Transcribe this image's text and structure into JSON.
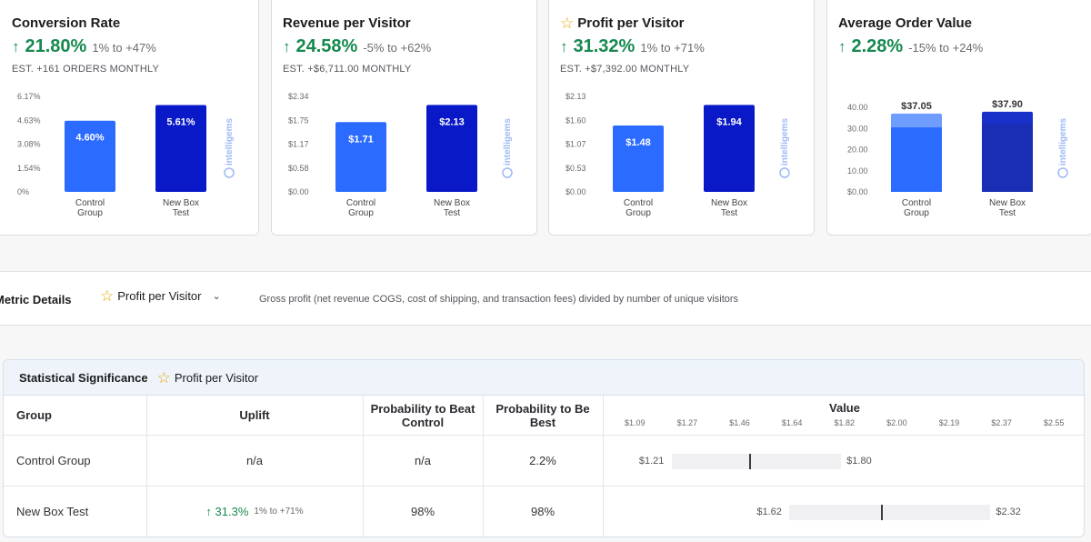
{
  "cards": [
    {
      "title": "Conversion Rate",
      "starred": false,
      "uplift": "21.80%",
      "range": "1% to +47%",
      "est": "EST. +161 ORDERS MONTHLY",
      "chart_data": {
        "type": "bar",
        "yticks": [
          "6.17%",
          "4.63%",
          "3.08%",
          "1.54%",
          "0%"
        ],
        "ymax": 6.17,
        "categories": [
          "Control Group",
          "New Box Test"
        ],
        "values": [
          4.6,
          5.61
        ],
        "labels": [
          "4.60%",
          "5.61%"
        ]
      }
    },
    {
      "title": "Revenue per Visitor",
      "starred": false,
      "uplift": "24.58%",
      "range": "-5% to +62%",
      "est": "EST. +$6,711.00 MONTHLY",
      "chart_data": {
        "type": "bar",
        "yticks": [
          "$2.34",
          "$1.75",
          "$1.17",
          "$0.58",
          "$0.00"
        ],
        "ymax": 2.34,
        "categories": [
          "Control Group",
          "New Box Test"
        ],
        "values": [
          1.71,
          2.13
        ],
        "labels": [
          "$1.71",
          "$2.13"
        ]
      }
    },
    {
      "title": "Profit per Visitor",
      "starred": true,
      "uplift": "31.32%",
      "range": "1% to +71%",
      "est": "EST. +$7,392.00 MONTHLY",
      "chart_data": {
        "type": "bar",
        "yticks": [
          "$2.13",
          "$1.60",
          "$1.07",
          "$0.53",
          "$0.00"
        ],
        "ymax": 2.13,
        "categories": [
          "Control Group",
          "New Box Test"
        ],
        "values": [
          1.48,
          1.94
        ],
        "labels": [
          "$1.48",
          "$1.94"
        ]
      }
    },
    {
      "title": "Average Order Value",
      "starred": false,
      "uplift": "2.28%",
      "range": "-15% to +24%",
      "est": "",
      "chart_data": {
        "type": "bar",
        "yticks": [
          "40.00",
          "30.00",
          "20.00",
          "10.00",
          "$0.00"
        ],
        "ymax": 40,
        "categories": [
          "Control Group",
          "New Box Test"
        ],
        "values": [
          37.05,
          37.9
        ],
        "labels": [
          "$37.05",
          "$37.90"
        ],
        "stacked_base": [
          30.5,
          32.0
        ]
      }
    }
  ],
  "brand_name": "intelligems",
  "details": {
    "label": "Metric Details",
    "selected_metric": "Profit per Visitor",
    "description": "Gross profit (net revenue COGS, cost of shipping, and transaction fees) divided by number of unique visitors"
  },
  "significance": {
    "title": "Statistical Significance",
    "metric": "Profit per Visitor",
    "headers": {
      "group": "Group",
      "uplift": "Uplift",
      "prob_beat": "Probability to Beat Control",
      "prob_best": "Probability to Be Best",
      "value": "Value"
    },
    "axis_ticks": [
      "$1.09",
      "$1.27",
      "$1.46",
      "$1.64",
      "$1.82",
      "$2.00",
      "$2.19",
      "$2.37",
      "$2.55"
    ],
    "axis_min": 1.09,
    "axis_max": 2.55,
    "rows": [
      {
        "group": "Control Group",
        "uplift": "n/a",
        "uplift_range": "",
        "prob_beat": "n/a",
        "prob_best": "2.2%",
        "ci_low": 1.21,
        "ci_high": 1.8,
        "mid": 1.48,
        "ci_low_label": "$1.21",
        "ci_high_label": "$1.80"
      },
      {
        "group": "New Box Test",
        "uplift": "31.3%",
        "uplift_range": "1% to +71%",
        "prob_beat": "98%",
        "prob_best": "98%",
        "ci_low": 1.62,
        "ci_high": 2.32,
        "mid": 1.94,
        "ci_low_label": "$1.62",
        "ci_high_label": "$2.32"
      }
    ]
  },
  "colors": {
    "control_bar": "#2b6bff",
    "test_bar": "#0a19c7",
    "uplift_green": "#16894f",
    "aov_light": "#6f9cff",
    "aov_dark": "#1a31c9"
  }
}
